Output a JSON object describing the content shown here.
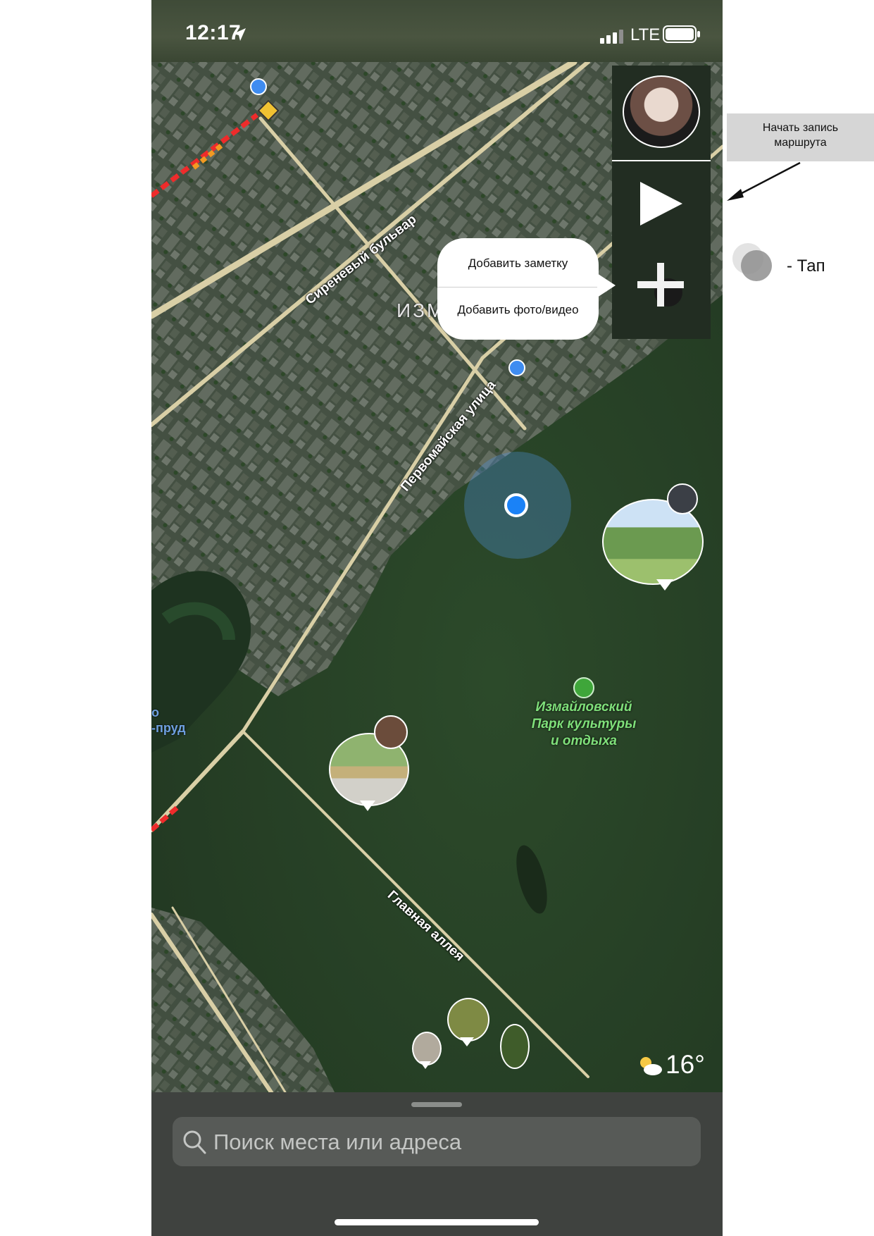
{
  "status_bar": {
    "time": "12:17",
    "network": "LTE"
  },
  "map": {
    "road_labels": {
      "sirenevy": "Сиреневый бульвар",
      "pervomayskaya": "Первомайская улица",
      "glavnaya": "Главная аллея",
      "district": "ИЗМ",
      "pond": "-пруд",
      "pond_prefix": "о"
    },
    "park_label_lines": [
      "Измайловский",
      "Парк культуры",
      "и отдыха"
    ]
  },
  "control_panel": {
    "start_route_icon": "play-icon",
    "add_icon": "plus-icon"
  },
  "add_menu": {
    "items": [
      "Добавить заметку",
      "Добавить фото/видео"
    ]
  },
  "weather": {
    "temperature": "16°",
    "icon": "partly-cloudy-icon"
  },
  "search": {
    "placeholder": "Поиск места или адреса"
  },
  "annotations": {
    "route_note_lines": [
      "Начать запись",
      "маршрута"
    ],
    "tap_legend": "-  Тап"
  },
  "colors": {
    "panel": "#222d22",
    "location_blue": "#1a82f7",
    "park_label": "#7fe07a",
    "sheet": "#3f423f"
  }
}
